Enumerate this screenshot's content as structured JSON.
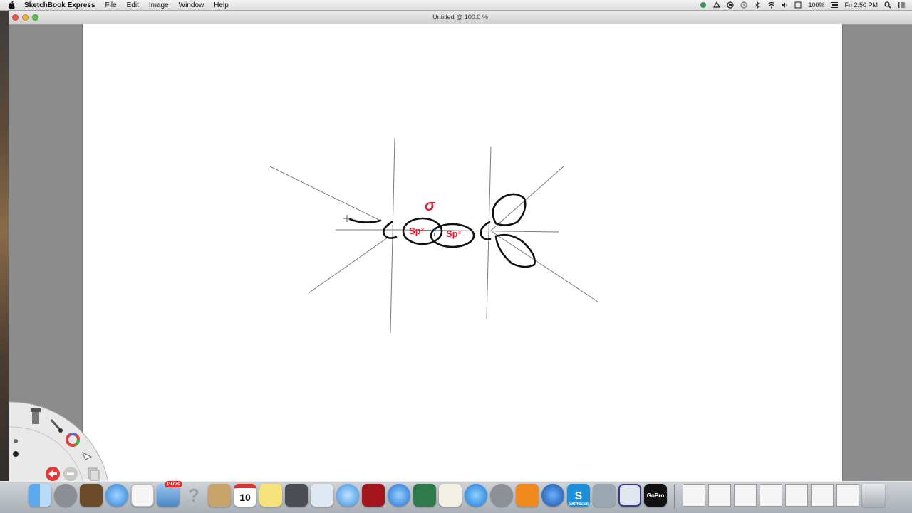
{
  "menubar": {
    "app_name": "SketchBook Express",
    "menus": [
      "File",
      "Edit",
      "Image",
      "Window",
      "Help"
    ],
    "battery": "100%",
    "clock": "Fri 2:50 PM"
  },
  "window": {
    "title": "Untitled @ 100.0 %"
  },
  "canvas": {
    "annotations": {
      "sigma": "σ",
      "left_lobe": "Sp²",
      "right_lobe": "Sp²"
    },
    "ink_colors": {
      "black": "#111111",
      "red": "#e01a2a",
      "blue": "#2a3fd8",
      "guide": "#7a7a7a"
    }
  },
  "dock": {
    "calendar_day": "10",
    "mail_badge": "10770",
    "sketchbook_label": "EXPRESS",
    "gopro_label": "GoPro"
  },
  "colors": {
    "menubar_bg": "#e8e8e8",
    "window_chrome": "#8c8c8c",
    "canvas_bg": "#ffffff",
    "dock_bg": "#bcc1c7"
  }
}
